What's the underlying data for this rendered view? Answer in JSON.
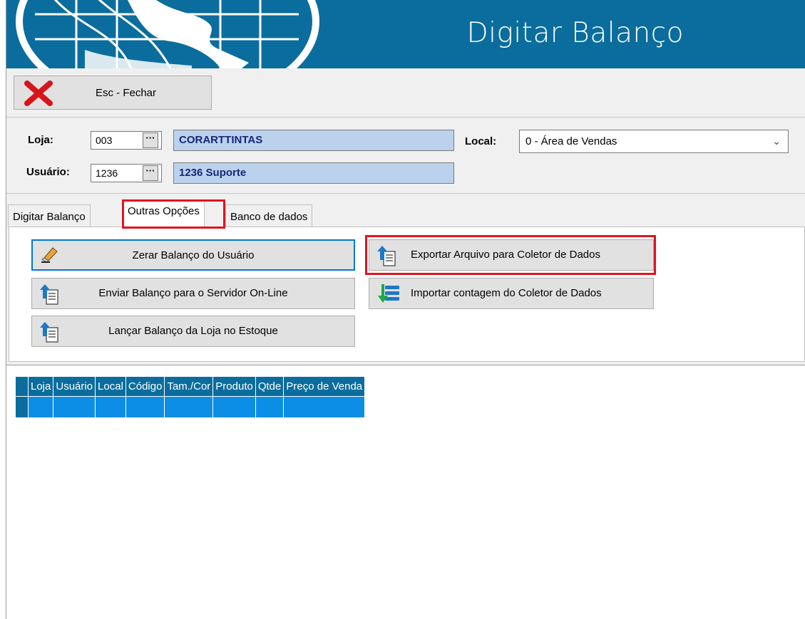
{
  "window": {
    "title": "Digitar Balanço"
  },
  "toolbar": {
    "close_label": "Esc - Fechar"
  },
  "filters": {
    "loja_label": "Loja:",
    "loja_code": "003",
    "loja_name": "CORARTTINTAS",
    "usuario_label": "Usuário:",
    "usuario_code": "1236",
    "usuario_name": "1236 Suporte",
    "local_label": "Local:",
    "local_value": "0 - Área de Vendas",
    "lookup_button": "···"
  },
  "tabs": [
    {
      "label": "Digitar Balanço"
    },
    {
      "label": "Outras Opções"
    },
    {
      "label": "Banco de dados"
    }
  ],
  "actions": {
    "zerar": "Zerar Balanço do Usuário",
    "enviar": "Enviar Balanço para o Servidor On-Line",
    "lancar": "Lançar Balanço da Loja no Estoque",
    "exportar": "Exportar Arquivo para Coletor de Dados",
    "importar": "Importar contagem do Coletor de Dados"
  },
  "grid": {
    "columns": [
      "Loja",
      "Usuário",
      "Local",
      "Código",
      "Tam./Cor",
      "Produto",
      "Qtde",
      "Preço de Venda"
    ]
  },
  "colors": {
    "header_blue": "#0b6d9d",
    "row_selected": "#0d8ee6",
    "name_field_bg": "#bcd2ec",
    "highlight_red": "#e0141e"
  }
}
